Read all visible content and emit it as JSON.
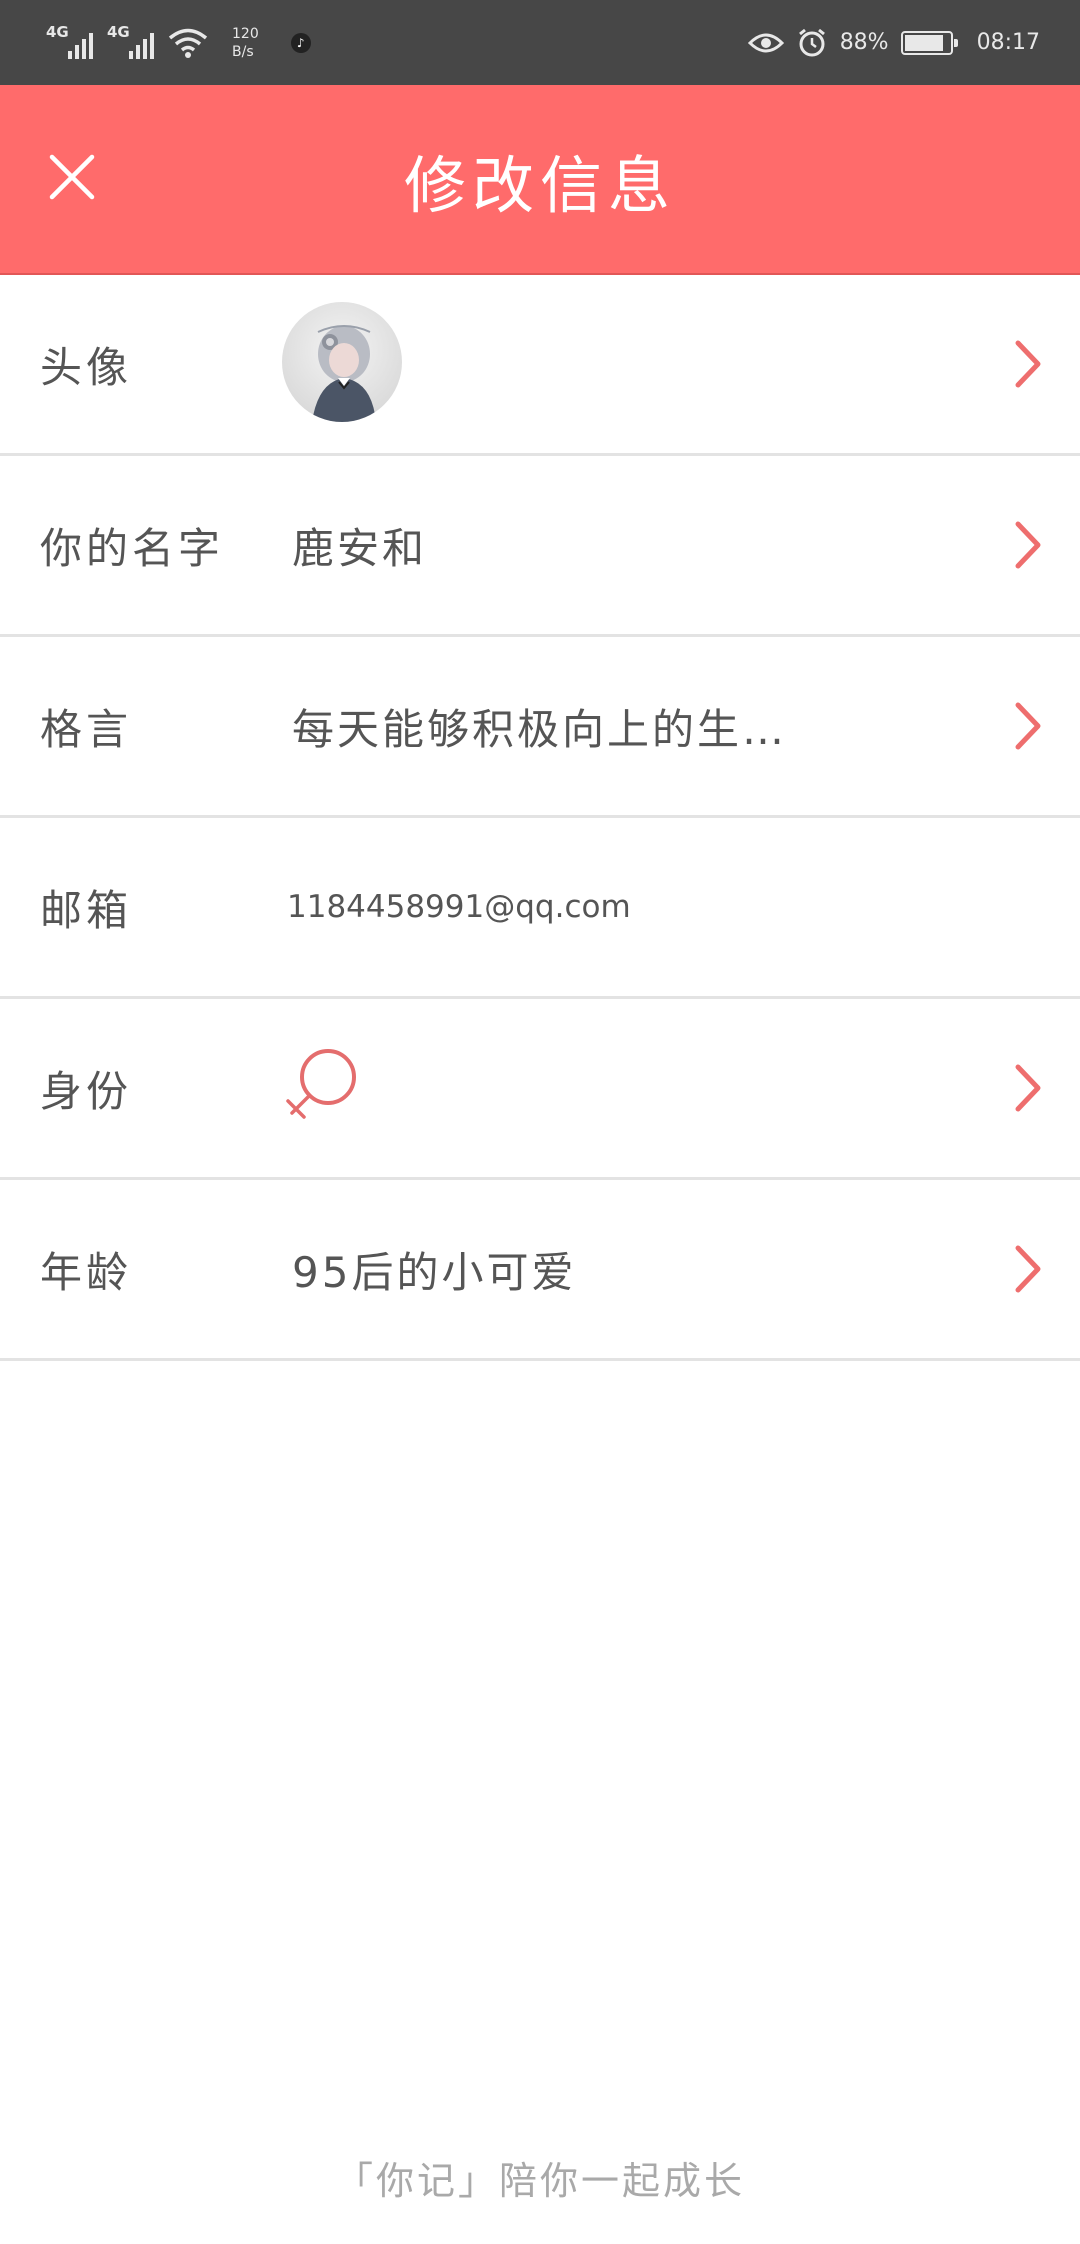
{
  "status_bar": {
    "signal1_label": "4G",
    "signal2_label": "4G",
    "speed_value": "120",
    "speed_unit": "B/s",
    "app_icon": "tiktok-icon",
    "battery_percent": "88%",
    "battery_level": 0.88,
    "time": "08:17",
    "icons": [
      "signal-icon",
      "signal-icon",
      "wifi-icon",
      "eye-icon",
      "alarm-icon",
      "battery-icon"
    ]
  },
  "header": {
    "title": "修改信息",
    "close_icon": "close-icon"
  },
  "colors": {
    "accent": "#ff6b6b",
    "chevron": "#ee6e6e",
    "gender_symbol": "#e46d6d",
    "status_bar_bg": "#474747"
  },
  "rows": [
    {
      "label": "头像",
      "type": "avatar",
      "chevron": true
    },
    {
      "label": "你的名字",
      "value": "鹿安和",
      "chevron": true
    },
    {
      "label": "格言",
      "value": "每天能够积极向上的生…",
      "chevron": true
    },
    {
      "label": "邮箱",
      "value": "1184458991@qq.com",
      "chevron": false
    },
    {
      "label": "身份",
      "type": "gender",
      "gender_icon": "female-symbol-icon",
      "chevron": true
    },
    {
      "label": "年龄",
      "value": "95后的小可爱",
      "chevron": true
    }
  ],
  "footer": {
    "text": "「你记」陪你一起成长"
  }
}
